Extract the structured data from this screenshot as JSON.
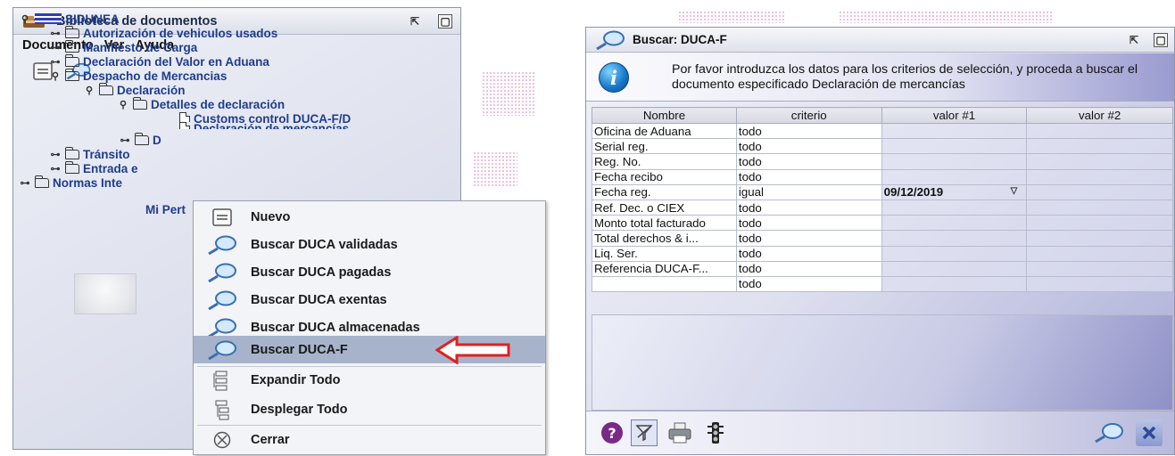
{
  "library": {
    "title": "Biblioteca de documentos",
    "menu": [
      "Documento",
      "Ver",
      "Ayuda"
    ],
    "tree": [
      {
        "label": "SIDUNEA"
      },
      {
        "label": "Autorización de vehiculos usados"
      },
      {
        "label": "Manifiesto de Carga"
      },
      {
        "label": "Declaración del Valor en Aduana"
      },
      {
        "label": "Despacho de Mercancias"
      },
      {
        "label": "Declaración"
      },
      {
        "label": "Detalles de declaración"
      },
      {
        "label": "Customs control DUCA-F/D"
      },
      {
        "label": "Declaración de mercancías"
      },
      {
        "label": "D"
      },
      {
        "label": "Tránsito"
      },
      {
        "label": "Entrada e"
      },
      {
        "label": "Normas Inte"
      }
    ],
    "profile_label": "Mi Pert"
  },
  "context_menu": {
    "items": [
      {
        "label": "Nuevo",
        "icon": "new-document-icon"
      },
      {
        "label": "Buscar DUCA validadas",
        "icon": "search-icon"
      },
      {
        "label": "Buscar DUCA pagadas",
        "icon": "search-icon"
      },
      {
        "label": "Buscar DUCA exentas",
        "icon": "search-icon"
      },
      {
        "label": "Buscar DUCA almacenadas",
        "icon": "search-icon"
      },
      {
        "label": "Buscar DUCA-F",
        "icon": "search-icon",
        "selected": true
      },
      {
        "label": "Expandir Todo",
        "icon": "expand-tree-icon"
      },
      {
        "label": "Desplegar Todo",
        "icon": "collapse-tree-icon"
      },
      {
        "label": "Cerrar",
        "icon": "close-circle-icon"
      }
    ],
    "highlight_color": "#a6b3cb",
    "arrow_color": "#e02020"
  },
  "search_window": {
    "title": "Buscar: DUCA-F",
    "info_text": "Por favor introduzca los datos para los criterios de selección, y proceda a buscar el documento especificado Declaración de mercancías",
    "columns": [
      "Nombre",
      "criterio",
      "valor #1",
      "valor #2"
    ],
    "rows": [
      [
        "Oficina de Aduana",
        "todo",
        "",
        ""
      ],
      [
        "Serial reg.",
        "todo",
        "",
        ""
      ],
      [
        "Reg. No.",
        "todo",
        "",
        ""
      ],
      [
        "Fecha recibo",
        "todo",
        "",
        ""
      ],
      [
        "Fecha reg.",
        "igual",
        "09/12/2019",
        ""
      ],
      [
        "Ref. Dec. o CIEX",
        "todo",
        "",
        ""
      ],
      [
        "Monto total facturado",
        "todo",
        "",
        ""
      ],
      [
        "Total derechos & i...",
        "todo",
        "",
        ""
      ],
      [
        "Liq. Ser.",
        "todo",
        "",
        ""
      ],
      [
        "Referencia DUCA-F...",
        "todo",
        "",
        ""
      ],
      [
        "",
        "todo",
        "",
        ""
      ]
    ],
    "bottom_buttons": [
      "help-icon",
      "clear-filter-icon",
      "print-icon",
      "traffic-light-icon",
      "search-icon",
      "close-icon"
    ]
  }
}
